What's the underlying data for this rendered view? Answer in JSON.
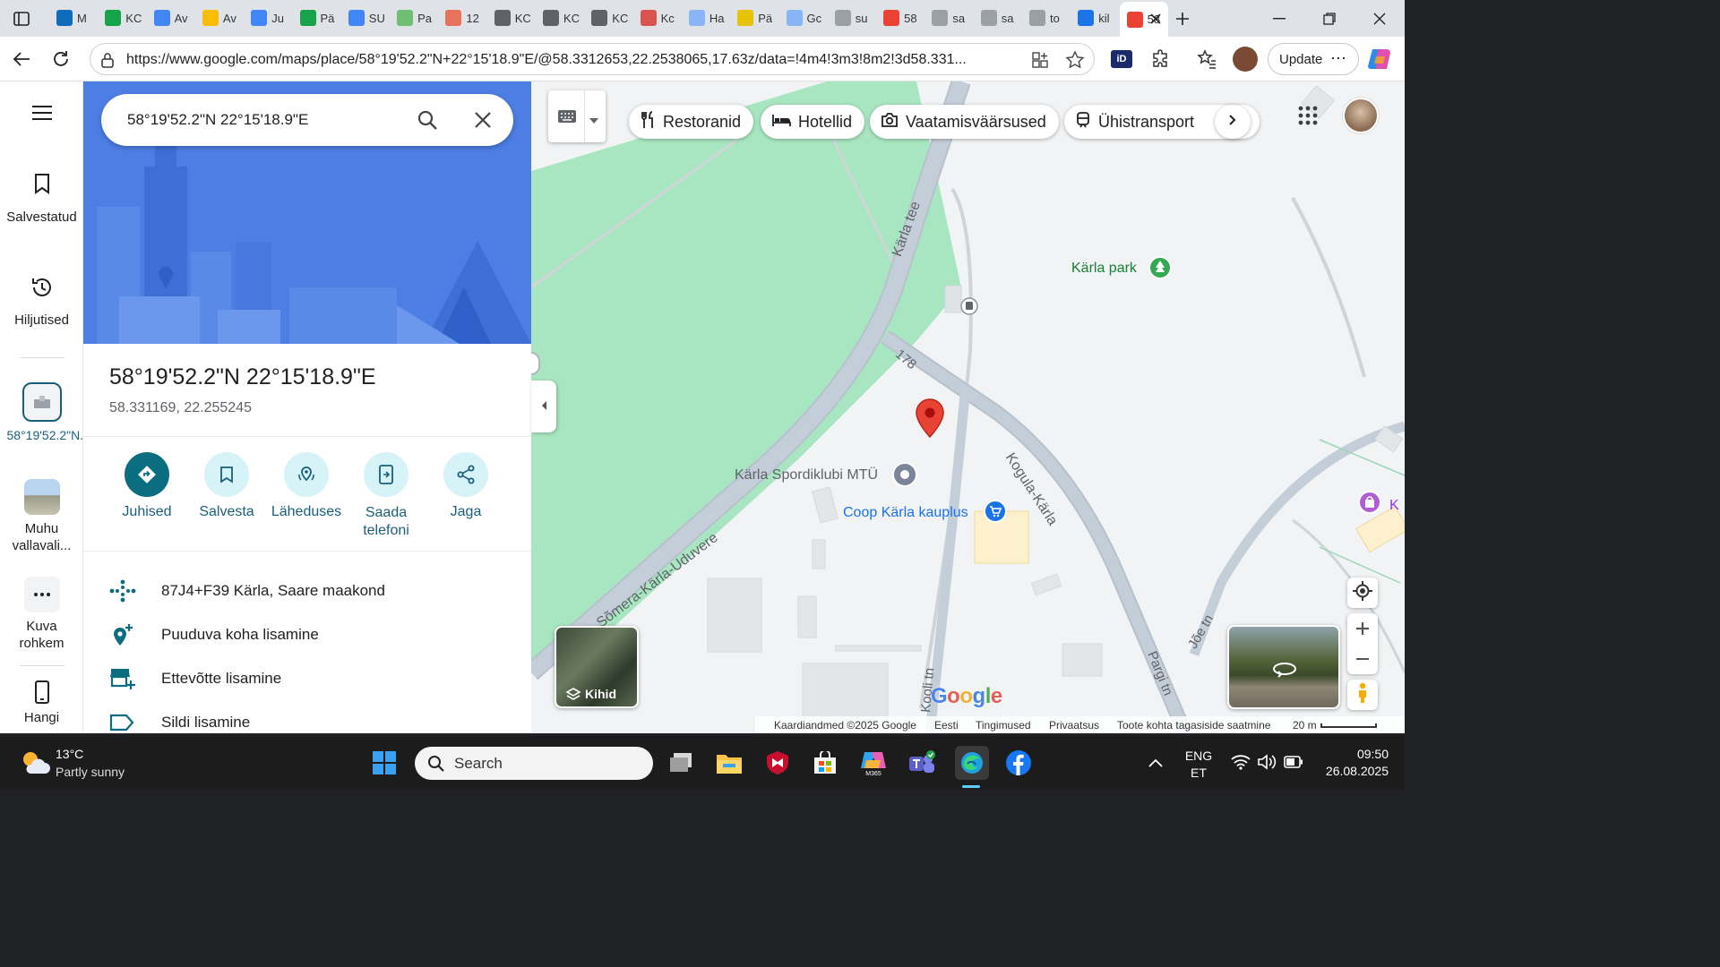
{
  "browser": {
    "tabs": [
      {
        "label": "M",
        "icon": "outlook-icon",
        "color": "#0f6cbd"
      },
      {
        "label": "KC",
        "icon": "sheets-icon",
        "color": "#16a34a"
      },
      {
        "label": "Av",
        "icon": "drive-icon",
        "color": "#4285f4"
      },
      {
        "label": "Av",
        "icon": "drive-icon",
        "color": "#fbbc04"
      },
      {
        "label": "Ju",
        "icon": "docs-icon",
        "color": "#4285f4"
      },
      {
        "label": "Pä",
        "icon": "sheets-icon",
        "color": "#16a34a"
      },
      {
        "label": "SU",
        "icon": "docs-icon",
        "color": "#4285f4"
      },
      {
        "label": "Pa",
        "icon": "sheets-icon",
        "color": "#6fbf73"
      },
      {
        "label": "12",
        "icon": "slides-icon",
        "color": "#e8735a"
      },
      {
        "label": "KC",
        "icon": "classroom-icon",
        "color": "#5f6368"
      },
      {
        "label": "KC",
        "icon": "classroom-icon",
        "color": "#5f6368"
      },
      {
        "label": "KC",
        "icon": "classroom-icon",
        "color": "#5f6368"
      },
      {
        "label": "Kc",
        "icon": "pdf-icon",
        "color": "#d9534f"
      },
      {
        "label": "Ha",
        "icon": "docs-icon",
        "color": "#8ab4f8"
      },
      {
        "label": "Pä",
        "icon": "photo-icon",
        "color": "#e6c200"
      },
      {
        "label": "Gc",
        "icon": "docs-icon",
        "color": "#8ab4f8"
      },
      {
        "label": "su",
        "icon": "search-icon",
        "color": "#9aa0a6"
      },
      {
        "label": "58",
        "icon": "maps-icon",
        "color": "#ea4335"
      },
      {
        "label": "sa",
        "icon": "search-icon",
        "color": "#9aa0a6"
      },
      {
        "label": "sa",
        "icon": "search-icon",
        "color": "#9aa0a6"
      },
      {
        "label": "to",
        "icon": "search-icon",
        "color": "#9aa0a6"
      },
      {
        "label": "kil",
        "icon": "search-icon",
        "color": "#1a73e8"
      },
      {
        "label": "58",
        "icon": "maps-icon",
        "color": "#ea4335"
      }
    ],
    "url": "https://www.google.com/maps/place/58°19'52.2\"N+22°15'18.9\"E/@58.3312653,22.2538065,17.63z/data=!4m4!3m3!8m2!3d58.331...",
    "update_label": "Update"
  },
  "rail": {
    "saved": "Salvestatud",
    "recent": "Hiljutised",
    "place": "58°19'52.2\"N...",
    "muhu": "Muhu vallavali...",
    "more": "Kuva rohkem",
    "get_app": "Hangi"
  },
  "panel": {
    "search_value": "58°19'52.2\"N 22°15'18.9\"E",
    "title": "58°19'52.2\"N 22°15'18.9\"E",
    "subtitle": "58.331169, 22.255245",
    "actions": {
      "directions": "Juhised",
      "save": "Salvesta",
      "nearby": "Läheduses",
      "send": "Saada telefoni",
      "share": "Jaga"
    },
    "rows": {
      "pluscode": "87J4+F39 Kärla, Saare maakond",
      "missing_place": "Puuduva koha lisamine",
      "add_business": "Ettevõtte lisamine",
      "add_label": "Sildi lisamine"
    }
  },
  "map": {
    "chips": {
      "restaurants": "Restoranid",
      "hotels": "Hotellid",
      "sights": "Vaatamisväärsused",
      "transit": "Ühistransport"
    },
    "labels": {
      "park": "Kärla park",
      "club": "Kärla Spordiklubi MTÜ",
      "shop": "Coop Kärla kauplus",
      "road_karla": "Kärla tee",
      "road_178": "178",
      "road_kogula": "Kogula-Kärla",
      "road_somera": "Sõmera-Kärla-Uduvere",
      "road_joe": "Jõe tn",
      "road_pargi": "Pargi tn",
      "road_kooli": "Kooli tn",
      "edge_k": "K"
    },
    "layers_label": "Kihid",
    "google": "Google",
    "footer": {
      "data": "Kaardiandmed ©2025 Google",
      "country": "Eesti",
      "terms": "Tingimused",
      "privacy": "Privaatsus",
      "feedback": "Toote kohta tagasiside saatmine",
      "scale": "20 m"
    }
  },
  "taskbar": {
    "temp": "13°C",
    "weather": "Partly sunny",
    "search_placeholder": "Search",
    "lang_top": "ENG",
    "lang_bottom": "ET",
    "time": "09:50",
    "date": "26.08.2025"
  }
}
